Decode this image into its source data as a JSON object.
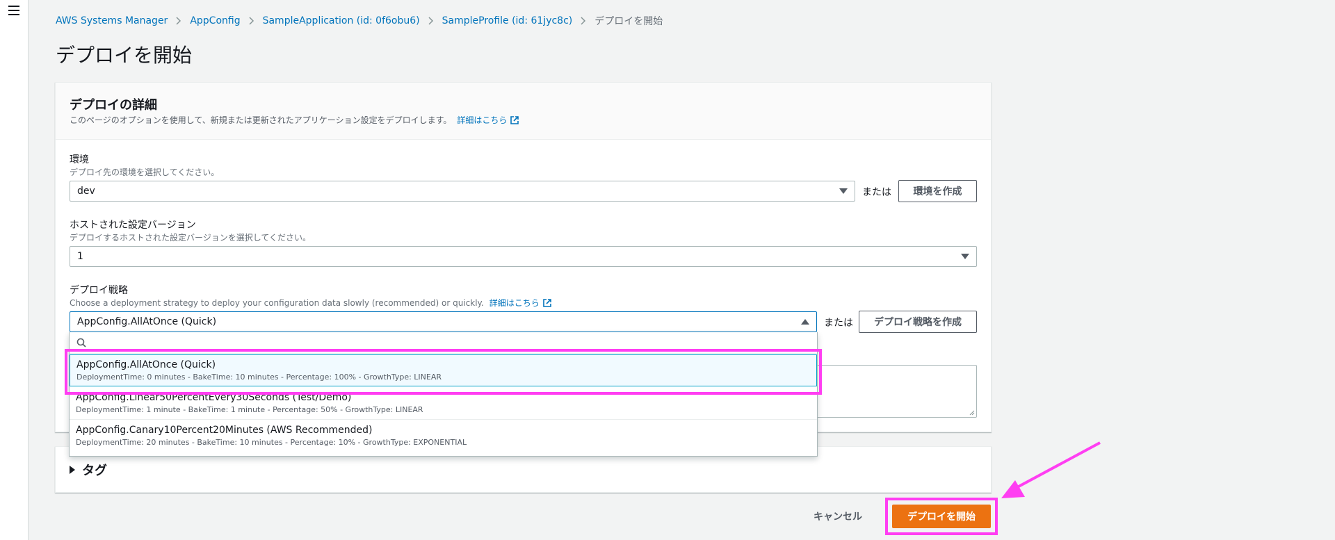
{
  "breadcrumb": {
    "items": [
      "AWS Systems Manager",
      "AppConfig",
      "SampleApplication (id: 0f6obu6)",
      "SampleProfile (id: 61jyc8c)"
    ],
    "current": "デプロイを開始"
  },
  "page": {
    "title": "デプロイを開始"
  },
  "details": {
    "title": "デプロイの詳細",
    "description": "このページのオプションを使用して、新規または更新されたアプリケーション設定をデプロイします。",
    "learn_more": "詳細はこちら"
  },
  "environment": {
    "label": "環境",
    "description": "デプロイ先の環境を選択してください。",
    "value": "dev",
    "or_text": "または",
    "create_button": "環境を作成"
  },
  "hosted_version": {
    "label": "ホストされた設定バージョン",
    "description": "デプロイするホストされた設定バージョンを選択してください。",
    "value": "1"
  },
  "strategy": {
    "label": "デプロイ戦略",
    "description": "Choose a deployment strategy to deploy your configuration data slowly (recommended) or quickly.",
    "learn_more": "詳細はこちら",
    "value": "AppConfig.AllAtOnce (Quick)",
    "or_text": "または",
    "create_button": "デプロイ戦略を作成",
    "options": [
      {
        "name": "AppConfig.AllAtOnce (Quick)",
        "detail": "DeploymentTime: 0 minutes - BakeTime: 10 minutes - Percentage: 100% - GrowthType: LINEAR",
        "selected": true
      },
      {
        "name": "AppConfig.Linear50PercentEvery30Seconds (Test/Demo)",
        "detail": "DeploymentTime: 1 minute - BakeTime: 1 minute - Percentage: 50% - GrowthType: LINEAR",
        "selected": false
      },
      {
        "name": "AppConfig.Canary10Percent20Minutes (AWS Recommended)",
        "detail": "DeploymentTime: 20 minutes - BakeTime: 10 minutes - Percentage: 10% - GrowthType: EXPONENTIAL",
        "selected": false
      }
    ]
  },
  "tags": {
    "title": "タグ"
  },
  "footer": {
    "cancel": "キャンセル",
    "submit": "デプロイを開始"
  },
  "colors": {
    "primary": "#ec7211",
    "link": "#0073bb",
    "highlight": "#ff3ef2",
    "selected_bg": "#f1faff"
  }
}
